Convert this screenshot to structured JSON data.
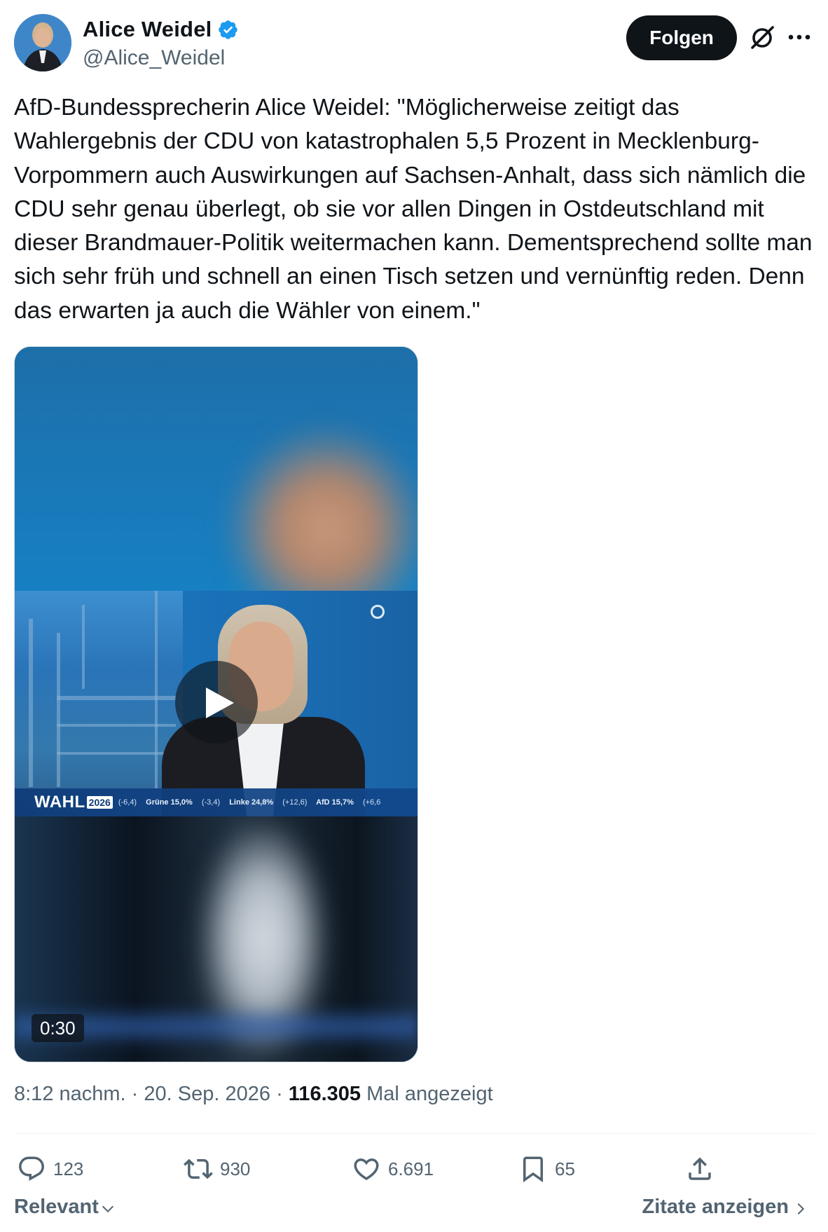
{
  "author": {
    "name": "Alice Weidel",
    "handle": "@Alice_Weidel",
    "verified": true,
    "verified_color": "#1d9bf0"
  },
  "header": {
    "follow_label": "Folgen",
    "grok_icon": "grok-icon",
    "more_icon": "more-icon"
  },
  "tweet": {
    "text": "AfD-Bundessprecherin Alice Weidel: \"Möglicherweise zeitigt das Wahlergebnis der CDU von katastrophalen 5,5 Prozent in Mecklenburg-Vorpommern auch Auswirkungen auf Sachsen-Anhalt, dass sich nämlich die CDU sehr genau überlegt, ob sie vor allen Dingen in Ostdeutschland mit dieser Brandmauer-Politik weitermachen kann. Dementsprechend sollte man sich sehr früh und schnell an einen Tisch setzen und vernünftig reden. Denn das erwarten ja auch die Wähler von einem.\""
  },
  "video": {
    "duration": "0:30",
    "ticker": {
      "label": "WAHL",
      "year": "2026",
      "items": [
        "(-6,4)",
        "Grüne 15,0%",
        "(-3,4)",
        "Linke 24,8%",
        "(+12,6)",
        "AfD 15,7%",
        "(+6,6"
      ]
    }
  },
  "meta": {
    "time": "8:12 nachm.",
    "date": "20. Sep. 2026",
    "views_count": "116.305",
    "views_label": "Mal angezeigt"
  },
  "actions": {
    "replies": "123",
    "reposts": "930",
    "likes": "6.691",
    "bookmarks": "65"
  },
  "footer": {
    "sort_label": "Relevant",
    "quotes_label": "Zitate anzeigen"
  }
}
